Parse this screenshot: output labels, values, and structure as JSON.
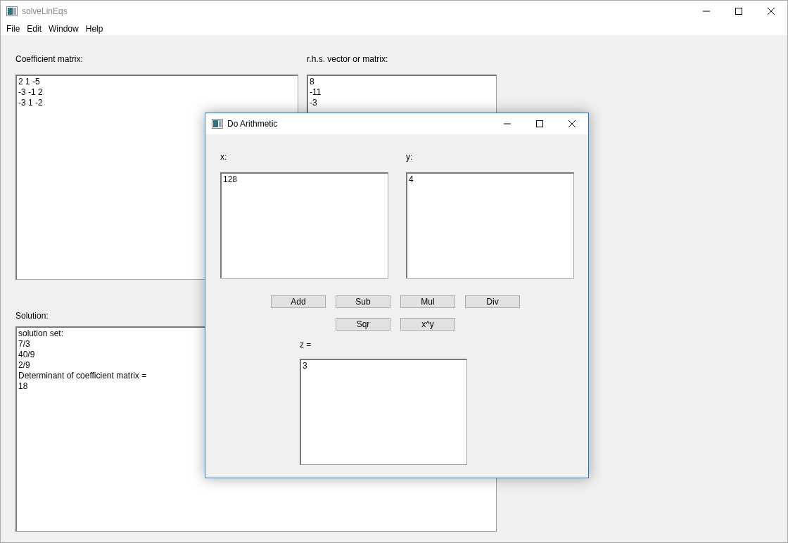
{
  "window": {
    "title": "solveLinEqs"
  },
  "menu": [
    "File",
    "Edit",
    "Window",
    "Help"
  ],
  "coefficient": {
    "label": "Coefficient matrix:",
    "lines": [
      "2 1 -5",
      "-3 -1 2",
      "-3 1 -2"
    ]
  },
  "rhs": {
    "label": "r.h.s. vector or matrix:",
    "lines": [
      "8",
      "-11",
      "-3"
    ]
  },
  "solution": {
    "label": "Solution:",
    "lines": [
      "solution set:",
      "7/3",
      "40/9",
      "2/9",
      "Determinant of coefficient matrix =",
      "18"
    ]
  },
  "dialog": {
    "title": "Do Arithmetic",
    "x": {
      "label": "x:",
      "lines": [
        "128"
      ]
    },
    "y": {
      "label": "y:",
      "lines": [
        "4"
      ]
    },
    "button_rows": [
      {
        "buttons": [
          "Add",
          "Sub",
          "Mul",
          "Div"
        ]
      },
      {
        "buttons": [
          "Sqr",
          "x^y"
        ]
      }
    ],
    "z": {
      "label": "z =",
      "lines": [
        "3"
      ]
    }
  }
}
